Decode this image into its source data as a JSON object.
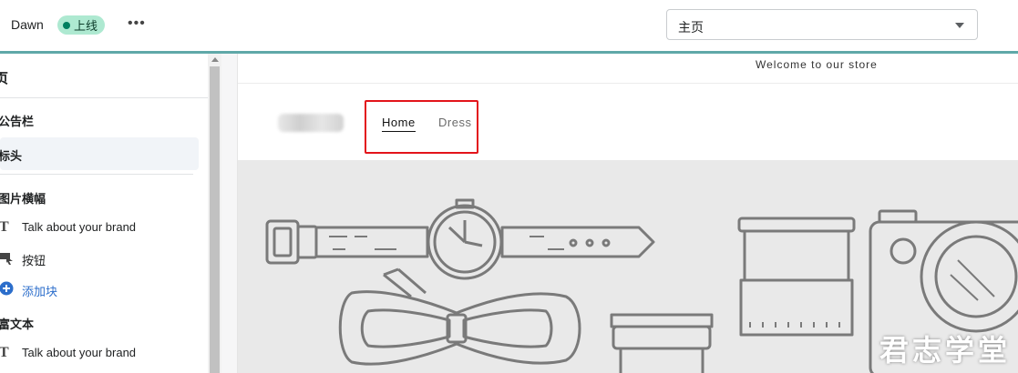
{
  "topbar": {
    "theme_name": "Dawn",
    "status_badge": "上线",
    "more_label": "•••",
    "page_select_value": "主页"
  },
  "sidebar": {
    "header": "页",
    "items": [
      {
        "type": "section",
        "label": "公告栏"
      },
      {
        "type": "item",
        "label": "标头",
        "selected": true
      },
      {
        "type": "section",
        "label": "图片横幅"
      },
      {
        "type": "block",
        "icon": "text-icon",
        "label": "Talk about your brand"
      },
      {
        "type": "block",
        "icon": "button-icon",
        "label": "按钮"
      },
      {
        "type": "add",
        "icon": "add-circle-icon",
        "label": "添加块"
      },
      {
        "type": "section",
        "label": "富文本"
      },
      {
        "type": "block",
        "icon": "text-icon",
        "label": "Talk about your brand"
      }
    ]
  },
  "preview": {
    "announcement": "Welcome to our store",
    "nav": [
      "Home",
      "Dress"
    ],
    "nav_active": "Home",
    "banner_image": "product-line-art-illustration"
  },
  "watermark": "君志学堂",
  "colors": {
    "badge_bg": "#aee9d1",
    "badge_dot": "#007f5f",
    "topbar_border": "#5fa8a8",
    "highlight_box": "#e3141a",
    "link": "#2c6ecb"
  }
}
